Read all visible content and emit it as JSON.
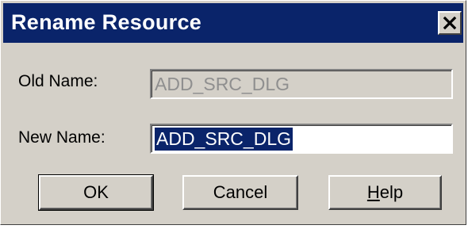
{
  "window": {
    "title": "Rename Resource"
  },
  "fields": {
    "old_name_label": "Old Name:",
    "old_name_value": "ADD_SRC_DLG",
    "new_name_label": "New Name:",
    "new_name_value": "ADD_SRC_DLG"
  },
  "buttons": {
    "ok": "OK",
    "cancel": "Cancel",
    "help_mnemonic": "H",
    "help_rest": "elp"
  },
  "icons": {
    "close": "close-icon"
  },
  "colors": {
    "titlebar": "#0a246a",
    "dialog_face": "#d4d0c8",
    "selection": "#0a246a"
  }
}
